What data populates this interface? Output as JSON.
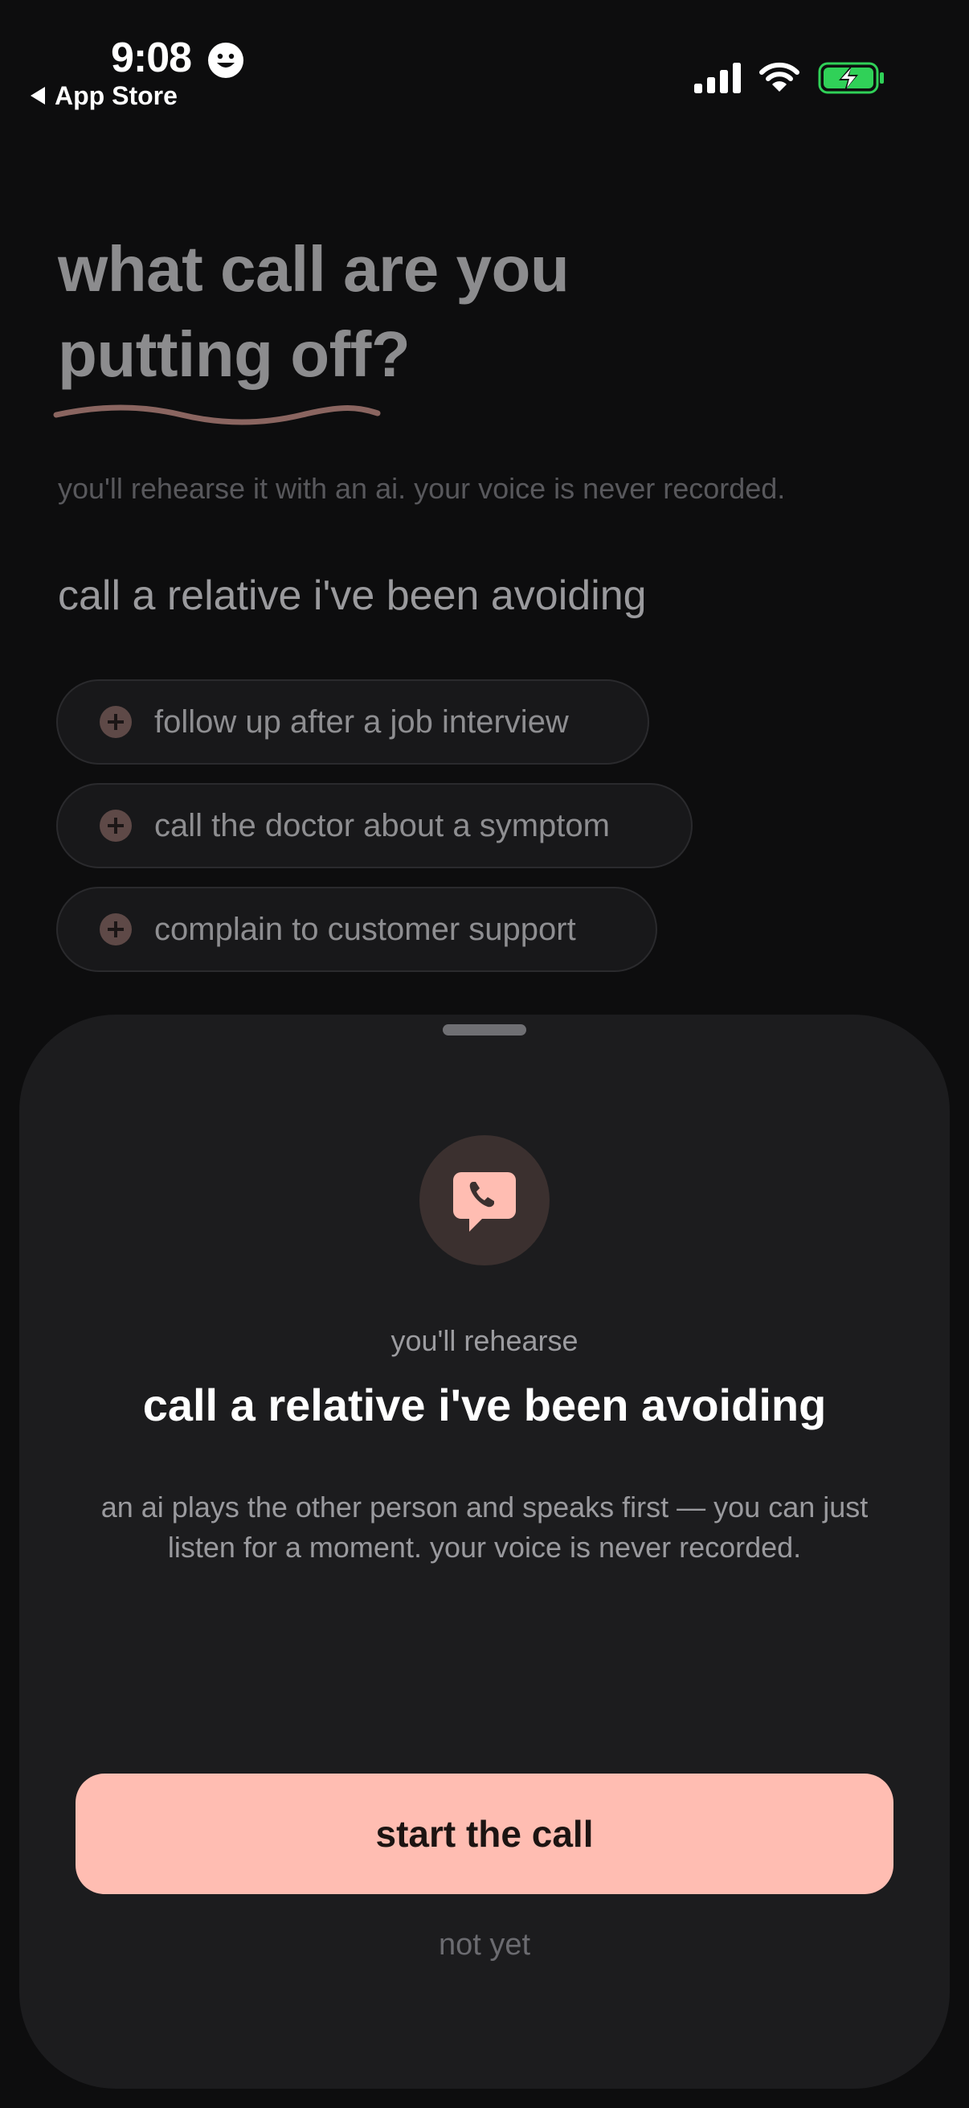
{
  "status_bar": {
    "time": "9:08",
    "back_label": "App Store",
    "icons": [
      "smiley-icon",
      "cellular-signal-icon",
      "wifi-icon",
      "battery-charging-icon"
    ],
    "battery_color": "#30d158"
  },
  "page": {
    "headline": "what call are you putting off?",
    "subtitle": "you'll rehearse it with an ai. your voice is never recorded.",
    "selected_goal": "call a relative i've been avoiding",
    "suggestions": [
      {
        "label": "follow up after a job interview",
        "icon": "plus-circle-icon"
      },
      {
        "label": "call the doctor about a symptom",
        "icon": "plus-circle-icon"
      },
      {
        "label": "complain to customer support",
        "icon": "plus-circle-icon"
      }
    ]
  },
  "sheet": {
    "icon": "phone-chat-bubble-icon",
    "eyebrow": "you'll rehearse",
    "title": "call a relative i've been avoiding",
    "description": "an ai plays the other person and speaks first — you can just listen for a moment. your voice is never recorded.",
    "primary_button": "start the call",
    "secondary_button": "not yet"
  },
  "colors": {
    "accent": "#ffbdb2",
    "background": "#0d0d0e",
    "sheet": "#1c1c1e"
  }
}
